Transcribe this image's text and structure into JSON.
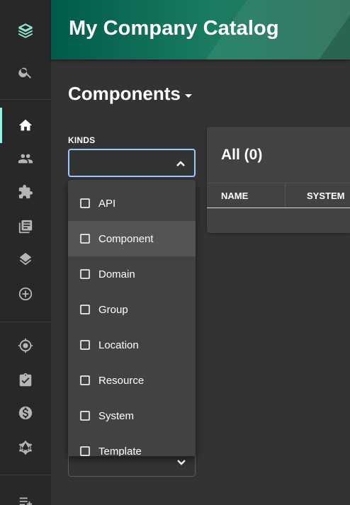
{
  "header": {
    "title": "My Company Catalog"
  },
  "page": {
    "title": "Components"
  },
  "filters": {
    "kinds_label": "KINDS",
    "kinds_options": [
      "API",
      "Component",
      "Domain",
      "Group",
      "Location",
      "Resource",
      "System",
      "Template"
    ],
    "hovered_option": "Component"
  },
  "table": {
    "title": "All (0)",
    "columns": [
      "NAME",
      "SYSTEM"
    ]
  },
  "sidebar": {
    "icons": [
      "logo-icon",
      "search-icon",
      "home-icon",
      "users-icon",
      "puzzle-icon",
      "docs-icon",
      "layers-icon",
      "create-icon",
      "target-icon",
      "clipboard-check-icon",
      "dollar-icon",
      "graphql-icon",
      "menu-add-icon"
    ],
    "active": "home-icon"
  },
  "colors": {
    "accent": "#9bf0e1",
    "select_focus": "#9cc9ff",
    "header_start": "#005b4b",
    "background": "#333333"
  }
}
